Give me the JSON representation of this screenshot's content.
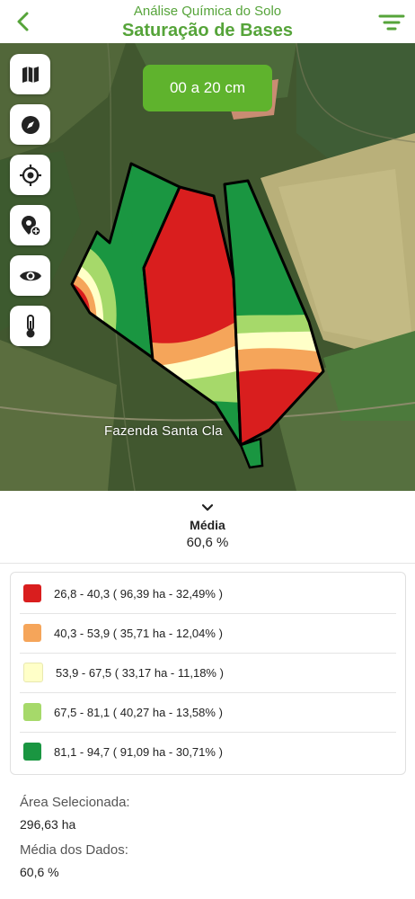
{
  "header": {
    "subtitle": "Análise Química do Solo",
    "title": "Saturação de Bases",
    "accent_color": "#56a43a",
    "back_icon": "chevron-left-icon",
    "menu_icon": "filter-menu-icon"
  },
  "map": {
    "depth_label": "00 a 20 cm",
    "farm_label": "Fazenda Santa Cla",
    "tools": [
      {
        "name": "map-layers",
        "icon": "map-icon"
      },
      {
        "name": "compass",
        "icon": "compass-icon"
      },
      {
        "name": "locate",
        "icon": "crosshair-icon"
      },
      {
        "name": "add-location",
        "icon": "pin-add-icon"
      },
      {
        "name": "visibility",
        "icon": "eye-icon"
      },
      {
        "name": "temperature",
        "icon": "thermometer-icon"
      }
    ]
  },
  "summary": {
    "label": "Média",
    "value": "60,6 %"
  },
  "legend": [
    {
      "text": "26,8 - 40,3 ( 96,39 ha - 32,49% )",
      "color": "#d91e1e"
    },
    {
      "text": "40,3 - 53,9 ( 35,71 ha - 12,04% )",
      "color": "#f5a55a"
    },
    {
      "text": "53,9 - 67,5 ( 33,17 ha - 11,18% )",
      "color": "#ffffc8"
    },
    {
      "text": "67,5 - 81,1 ( 40,27 ha - 13,58% )",
      "color": "#a6d96a"
    },
    {
      "text": "81,1 - 94,7 ( 91,09 ha - 30,71% )",
      "color": "#1a9641"
    }
  ],
  "info": {
    "area_label": "Área Selecionada:",
    "area_value": "296,63 ha",
    "mean_label": "Média dos Dados:",
    "mean_value": "60,6 %"
  }
}
